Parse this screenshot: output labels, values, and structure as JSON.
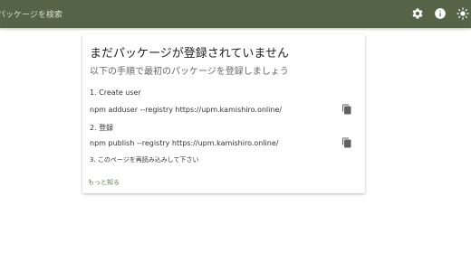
{
  "header": {
    "search_placeholder": "パッケージを検索",
    "icons": [
      "gear-icon",
      "info-icon",
      "brightness-icon"
    ],
    "background_color": "#556447"
  },
  "card": {
    "title": "まだパッケージが登録されていません",
    "subtitle": "以下の手順で最初のパッケージを登録しましょう",
    "steps": [
      {
        "label": "1. Create user",
        "command": "npm adduser --registry https://upm.kamishiro.online/"
      },
      {
        "label": "2. 登録",
        "command": "npm publish --registry https://upm.kamishiro.online/"
      }
    ],
    "note": "3. このページを再読み込みして下さい",
    "more_link": "もっと知る",
    "link_color": "#6b7a4f"
  }
}
